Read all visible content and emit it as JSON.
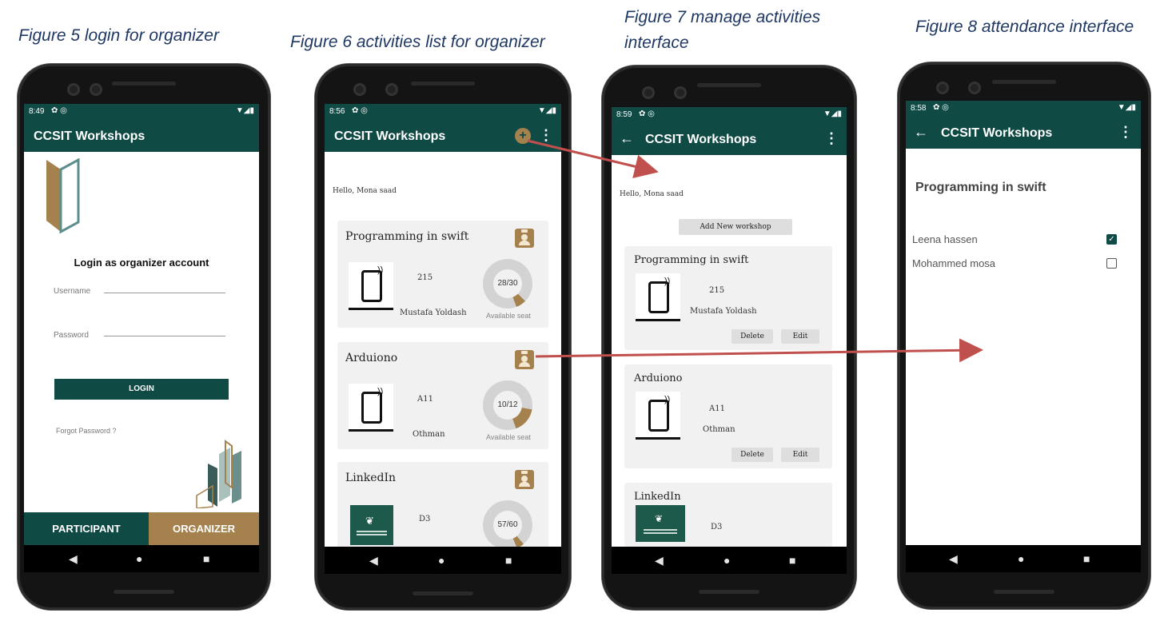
{
  "captions": {
    "fig5": "Figure 5 login for organizer",
    "fig6": "Figure 6 activities list for organizer",
    "fig7a": "Figure 7 manage activities",
    "fig7b": "interface",
    "fig8": "Figure 8 attendance interface"
  },
  "colors": {
    "appbar": "#0f4a45",
    "accent": "#a5814e",
    "arrow": "#c0504d"
  },
  "login_screen": {
    "status_time": "8:49",
    "app_title": "CCSIT Workshops",
    "heading": "Login as organizer account",
    "username_label": "Username",
    "password_label": "Password",
    "login_button": "LOGIN",
    "forgot_password": "Forgot Password ?",
    "tab_participant": "PARTICIPANT",
    "tab_organizer": "ORGANIZER"
  },
  "activities_screen": {
    "status_time": "8:56",
    "app_title": "CCSIT Workshops",
    "greeting": "Hello, Mona saad",
    "seat_caption": "Available seat",
    "activities": [
      {
        "title": "Programming in swift",
        "room": "215",
        "instructor": "Mustafa Yoldash",
        "seats": "28/30",
        "fill": 0.067
      },
      {
        "title": "Arduiono",
        "room": "A11",
        "instructor": "Othman",
        "seats": "10/12",
        "fill": 0.167
      },
      {
        "title": "LinkedIn",
        "room": "D3",
        "instructor": "",
        "seats": "57/60",
        "fill": 0.05
      }
    ]
  },
  "manage_screen": {
    "status_time": "8:59",
    "app_title": "CCSIT Workshops",
    "greeting": "Hello, Mona saad",
    "add_button": "Add New workshop",
    "delete_label": "Delete",
    "edit_label": "Edit",
    "activities": [
      {
        "title": "Programming in swift",
        "room": "215",
        "instructor": "Mustafa Yoldash"
      },
      {
        "title": "Arduiono",
        "room": "A11",
        "instructor": "Othman"
      },
      {
        "title": "LinkedIn",
        "room": "D3",
        "instructor": ""
      }
    ]
  },
  "attendance_screen": {
    "status_time": "8:58",
    "app_title": "CCSIT Workshops",
    "workshop_title": "Programming in swift",
    "attendees": [
      {
        "name": "Leena hassen",
        "checked": true
      },
      {
        "name": "Mohammed mosa",
        "checked": false
      }
    ]
  }
}
